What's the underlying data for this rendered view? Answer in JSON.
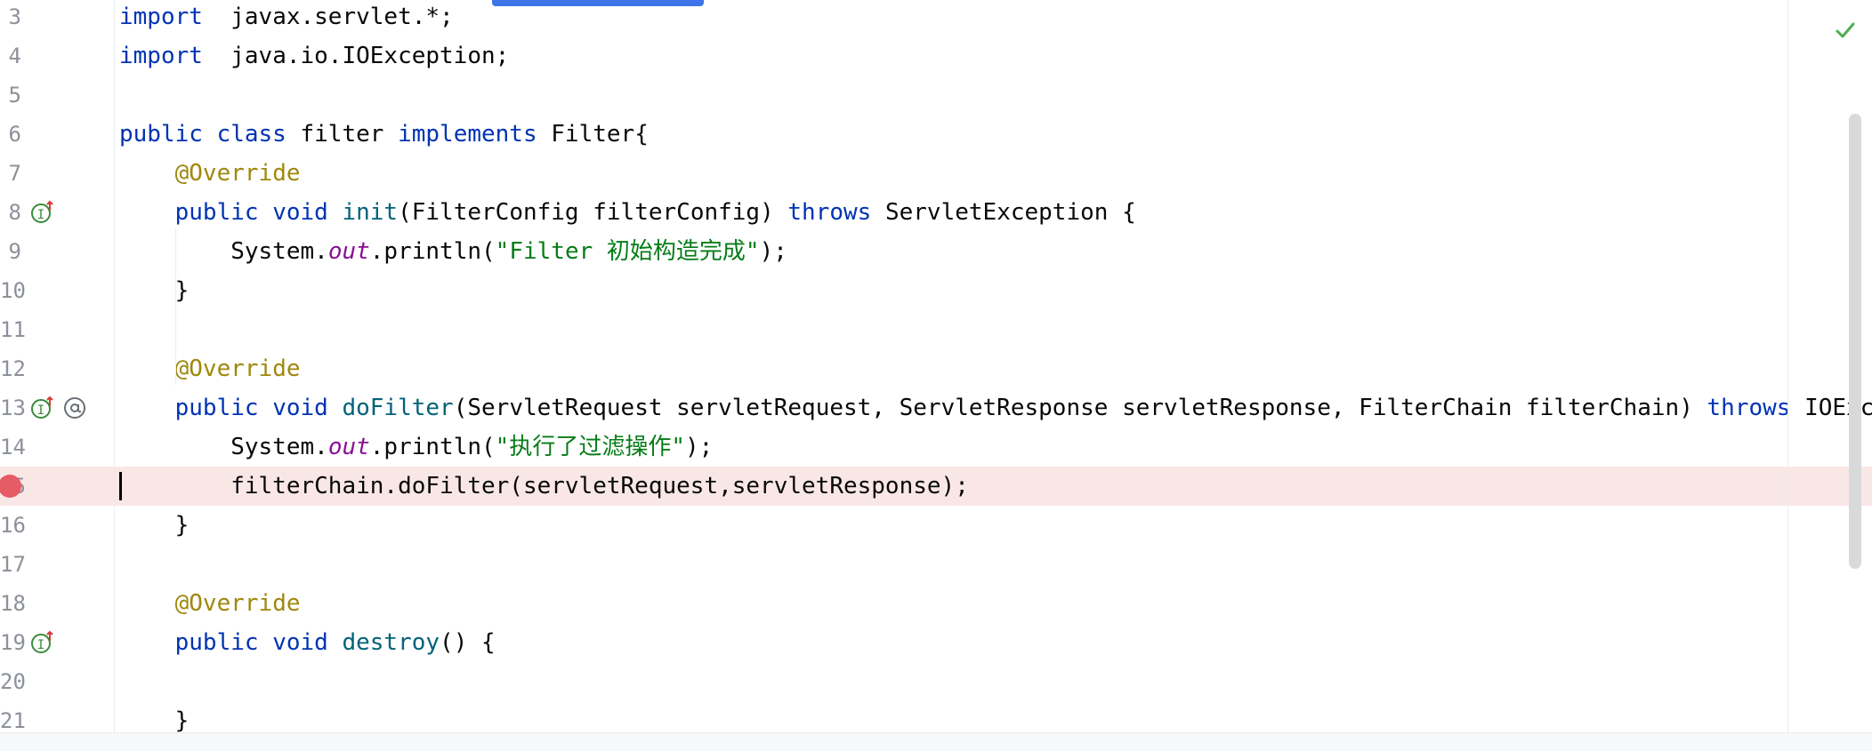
{
  "editor": {
    "lines": [
      {
        "num": "3",
        "tokens": [
          [
            "kw",
            "import"
          ],
          [
            "",
            "  javax.servlet.*;"
          ]
        ]
      },
      {
        "num": "4",
        "tokens": [
          [
            "kw",
            "import"
          ],
          [
            "",
            "  java.io.IOException;"
          ]
        ]
      },
      {
        "num": "5",
        "tokens": []
      },
      {
        "num": "6",
        "tokens": [
          [
            "kw",
            "public class"
          ],
          [
            "",
            " filter "
          ],
          [
            "kw",
            "implements"
          ],
          [
            "",
            " Filter{"
          ]
        ]
      },
      {
        "num": "7",
        "tokens": [
          [
            "",
            "    "
          ],
          [
            "ann",
            "@Override"
          ]
        ]
      },
      {
        "num": "8",
        "tokens": [
          [
            "",
            "    "
          ],
          [
            "kw",
            "public void"
          ],
          [
            "",
            " "
          ],
          [
            "fn",
            "init"
          ],
          [
            "",
            "(FilterConfig filterConfig) "
          ],
          [
            "kw",
            "throws"
          ],
          [
            "",
            " ServletException {"
          ]
        ]
      },
      {
        "num": "9",
        "tokens": [
          [
            "",
            "        System."
          ],
          [
            "fld",
            "out"
          ],
          [
            "",
            ".println("
          ],
          [
            "str",
            "\"Filter 初始构造完成\""
          ],
          [
            "",
            ");"
          ]
        ]
      },
      {
        "num": "10",
        "tokens": [
          [
            "",
            "    }"
          ]
        ]
      },
      {
        "num": "11",
        "tokens": []
      },
      {
        "num": "12",
        "tokens": [
          [
            "",
            "    "
          ],
          [
            "ann",
            "@Override"
          ]
        ]
      },
      {
        "num": "13",
        "tokens": [
          [
            "",
            "    "
          ],
          [
            "kw",
            "public void"
          ],
          [
            "",
            " "
          ],
          [
            "fn",
            "doFilter"
          ],
          [
            "",
            "(ServletRequest servletRequest, ServletResponse servletResponse, FilterChain filterChain) "
          ],
          [
            "kw",
            "throws"
          ],
          [
            "",
            " IOExc"
          ]
        ]
      },
      {
        "num": "14",
        "tokens": [
          [
            "",
            "        System."
          ],
          [
            "fld",
            "out"
          ],
          [
            "",
            ".println("
          ],
          [
            "str",
            "\"执行了过滤操作\""
          ],
          [
            "",
            ");"
          ]
        ]
      },
      {
        "num": "15",
        "tokens": [
          [
            "",
            "        filterChain.doFilter(servletRequest,servletResponse);"
          ]
        ],
        "breakpoint": true
      },
      {
        "num": "16",
        "tokens": [
          [
            "",
            "    }"
          ]
        ]
      },
      {
        "num": "17",
        "tokens": []
      },
      {
        "num": "18",
        "tokens": [
          [
            "",
            "    "
          ],
          [
            "ann",
            "@Override"
          ]
        ]
      },
      {
        "num": "19",
        "tokens": [
          [
            "",
            "    "
          ],
          [
            "kw",
            "public void"
          ],
          [
            "",
            " "
          ],
          [
            "fn",
            "destroy"
          ],
          [
            "",
            "() {"
          ]
        ]
      },
      {
        "num": "20",
        "tokens": []
      },
      {
        "num": "21",
        "tokens": [
          [
            "",
            "    }"
          ]
        ]
      }
    ],
    "gutter_icons": {
      "8": [
        "implements-up-icon"
      ],
      "13": [
        "implements-up-icon",
        "at-annotation-icon"
      ],
      "19": [
        "implements-up-icon"
      ]
    },
    "status_icon": "check-icon"
  },
  "colors": {
    "keyword": "#0033b3",
    "annotation": "#9e880d",
    "method": "#00627a",
    "string": "#067d17",
    "field": "#871094",
    "breakpoint_line": "#f9e7e6",
    "breakpoint_dot": "#e55b66"
  }
}
